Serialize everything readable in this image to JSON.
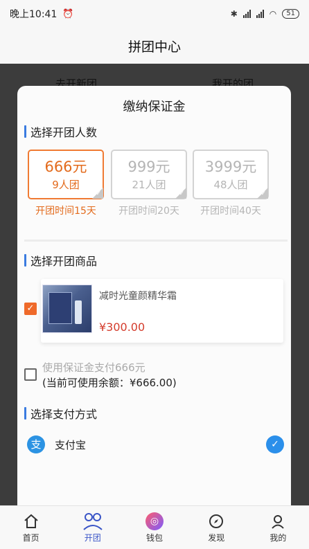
{
  "status_bar": {
    "time": "晚上10:41",
    "battery": "51"
  },
  "header": {
    "title": "拼团中心"
  },
  "background_tabs": {
    "left": "去开新团",
    "right": "我开的团"
  },
  "sheet": {
    "title": "缴纳保证金",
    "group_size_section": {
      "heading": "选择开团人数",
      "options": [
        {
          "price": "666元",
          "members": "9人团",
          "duration": "开团时间15天",
          "selected": true
        },
        {
          "price": "999元",
          "members": "21人团",
          "duration": "开团时间20天",
          "selected": false
        },
        {
          "price": "3999元",
          "members": "48人团",
          "duration": "开团时间40天",
          "selected": false
        }
      ]
    },
    "product_section": {
      "heading": "选择开团商品",
      "product": {
        "name": "减时光童颜精华霜",
        "price": "¥300.00",
        "checked": true
      }
    },
    "deposit": {
      "label": "使用保证金支付666元",
      "balance": "(当前可使用余额：¥666.00)",
      "checked": false
    },
    "payment_section": {
      "heading": "选择支付方式",
      "method": {
        "icon": "alipay-icon",
        "label": "支付宝",
        "selected": true
      }
    }
  },
  "bottom_nav": [
    {
      "label": "首页",
      "icon": "home-icon",
      "active": false
    },
    {
      "label": "开团",
      "icon": "group-icon",
      "active": true
    },
    {
      "label": "钱包",
      "icon": "wallet-icon",
      "active": false
    },
    {
      "label": "发现",
      "icon": "compass-icon",
      "active": false
    },
    {
      "label": "我的",
      "icon": "profile-icon",
      "active": false
    }
  ],
  "colors": {
    "accent_orange": "#ef6a2a",
    "accent_blue": "#2b8fea",
    "price_red": "#d43c2c",
    "nav_active": "#3a55c7"
  }
}
